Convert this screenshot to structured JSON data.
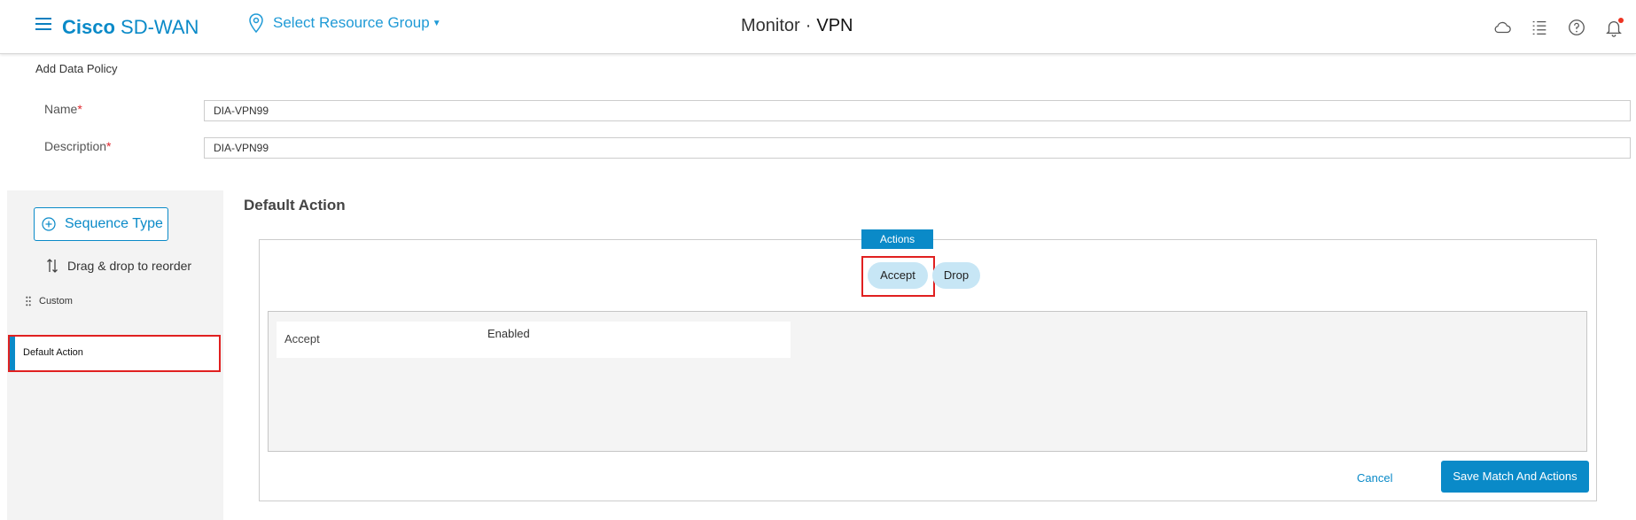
{
  "header": {
    "brand_bold": "Cisco",
    "brand_rest": "SD-WAN",
    "resource_group_label": "Select Resource Group",
    "title_left": "Monitor",
    "title_sep": "·",
    "title_right": "VPN",
    "icons": [
      "cloud-icon",
      "list-icon",
      "help-icon",
      "bell-icon"
    ]
  },
  "form": {
    "section_title": "Add Data Policy",
    "required_marker": "*",
    "name_label": "Name",
    "name_value": "DIA-VPN99",
    "description_label": "Description",
    "description_value": "DIA-VPN99"
  },
  "sidebar": {
    "sequence_type_button": "Sequence Type",
    "drag_hint": "Drag & drop to reorder",
    "items": [
      {
        "label": "Custom"
      },
      {
        "label": "Default Action"
      }
    ]
  },
  "main": {
    "title": "Default Action",
    "actions_tab": "Actions",
    "accept_label": "Accept",
    "drop_label": "Drop",
    "rows": [
      {
        "key": "Accept",
        "value": "Enabled"
      }
    ],
    "cancel_label": "Cancel",
    "save_label": "Save Match And Actions"
  },
  "colors": {
    "brand": "#0a8ac8",
    "accent_pill": "#c7e6f5",
    "highlight_box": "#e02020"
  }
}
